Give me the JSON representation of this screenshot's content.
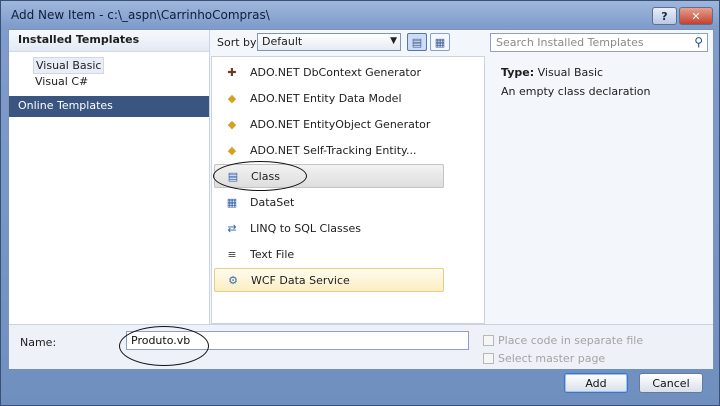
{
  "window": {
    "title": "Add New Item - c:\\_aspn\\CarrinhoCompras\\",
    "help_label": "?",
    "close_label": "✕"
  },
  "left_panel": {
    "installed_header": "Installed Templates",
    "items": [
      "Visual Basic",
      "Visual C#"
    ],
    "online": "Online Templates"
  },
  "toolbar": {
    "sort_label": "Sort by:",
    "sort_value": "Default",
    "sort_arrow": "▼",
    "view_list_icon": "▤",
    "view_grid_icon": "▦",
    "search_placeholder": "Search Installed Templates",
    "search_icon": "⚲"
  },
  "templates": [
    {
      "name": "ADO.NET DbContext Generator",
      "icon": "dbcontext-icon",
      "glyph": "✚",
      "color": "#6b3a2a"
    },
    {
      "name": "ADO.NET Entity Data Model",
      "icon": "entity-icon",
      "glyph": "◆",
      "color": "#d4a21e"
    },
    {
      "name": "ADO.NET EntityObject Generator",
      "icon": "generator-icon",
      "glyph": "◆",
      "color": "#d4a21e"
    },
    {
      "name": "ADO.NET Self-Tracking Entity...",
      "icon": "tracking-icon",
      "glyph": "◆",
      "color": "#d4a21e"
    },
    {
      "name": "Class",
      "icon": "class-icon",
      "glyph": "▤",
      "color": "#2c5fa8"
    },
    {
      "name": "DataSet",
      "icon": "dataset-icon",
      "glyph": "▦",
      "color": "#2c5fa8"
    },
    {
      "name": "LINQ to SQL Classes",
      "icon": "linq-icon",
      "glyph": "⇄",
      "color": "#2c5fa8"
    },
    {
      "name": "Text File",
      "icon": "textfile-icon",
      "glyph": "≡",
      "color": "#4a4a4a"
    },
    {
      "name": "WCF Data Service",
      "icon": "wcf-icon",
      "glyph": "⚙",
      "color": "#3a6bb0"
    }
  ],
  "details": {
    "type_label": "Type:",
    "type_value": "Visual Basic",
    "description": "An empty class declaration"
  },
  "name_field": {
    "label": "Name:",
    "value": "Produto.vb"
  },
  "options": {
    "separate_file": "Place code in separate file",
    "master_page": "Select master page"
  },
  "buttons": {
    "add": "Add",
    "cancel": "Cancel"
  }
}
